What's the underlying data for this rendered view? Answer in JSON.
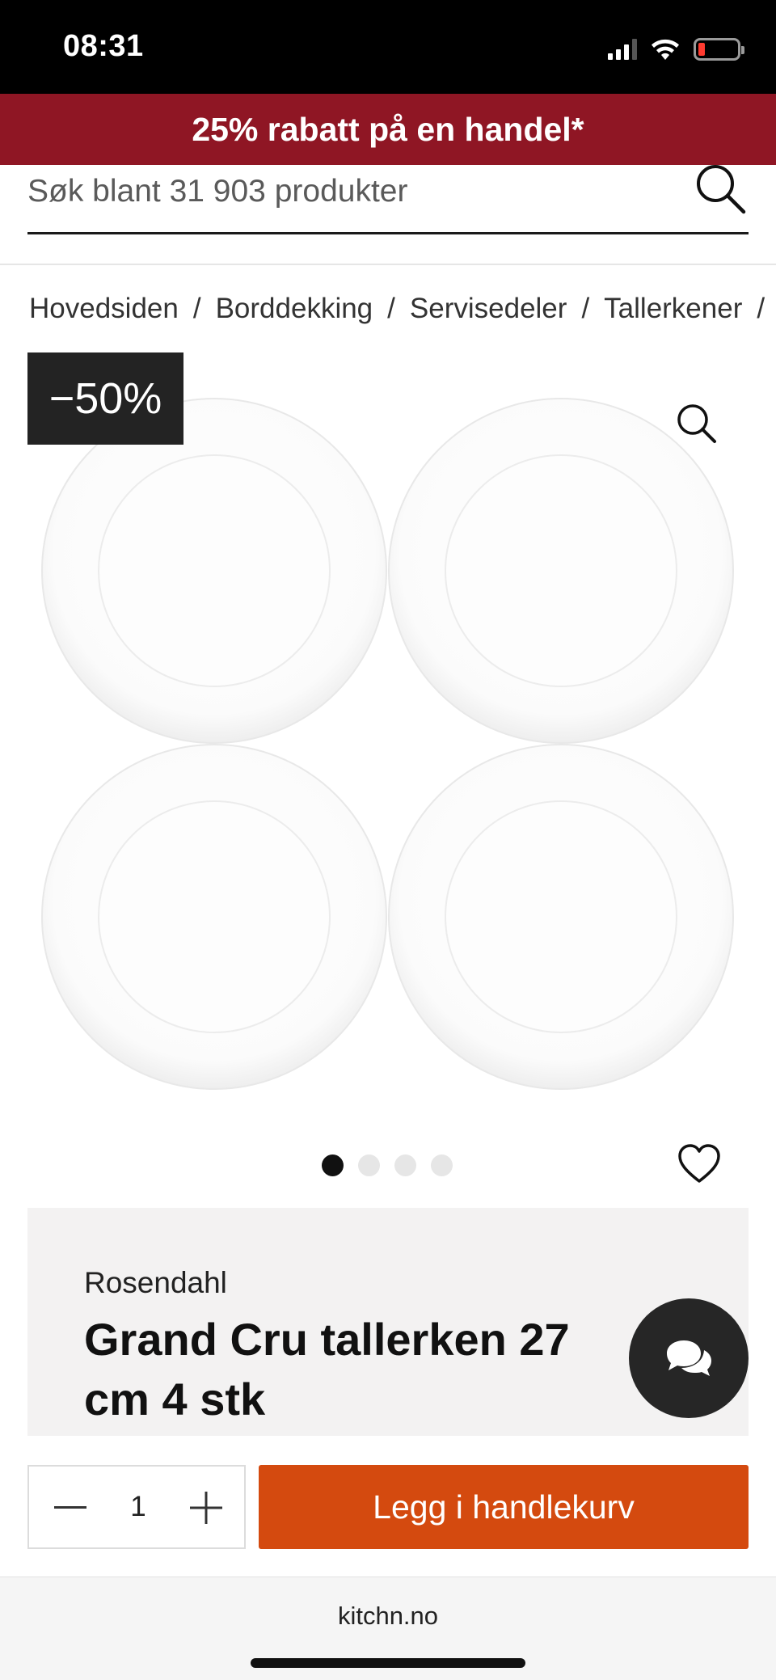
{
  "status_bar": {
    "time": "08:31",
    "icons": [
      "signal-icon",
      "wifi-icon",
      "battery-low-icon"
    ]
  },
  "promo": {
    "text": "25% rabatt på en handel*"
  },
  "search": {
    "placeholder": "Søk blant 31 903 produkter",
    "icon": "search-icon"
  },
  "breadcrumb": {
    "items": [
      "Hovedsiden",
      "Borddekking",
      "Servisedeler",
      "Tallerkener"
    ],
    "separator": "/"
  },
  "gallery": {
    "discount_badge": "−50%",
    "image_count": 4,
    "active_image_index": 0,
    "zoom_icon": "zoom-icon",
    "favorite_icon": "heart-icon"
  },
  "product": {
    "brand": "Rosendahl",
    "title": "Grand Cru tallerken 27 cm 4 stk"
  },
  "chat": {
    "icon": "chat-bubbles-icon"
  },
  "purchase": {
    "quantity": "1",
    "add_to_cart_label": "Legg i handlekurv"
  },
  "browser": {
    "url": "kitchn.no"
  },
  "colors": {
    "promo_bg": "#8f1624",
    "cta_bg": "#d44a0f",
    "badge_bg": "#232323",
    "info_bg": "#f3f2f2"
  }
}
